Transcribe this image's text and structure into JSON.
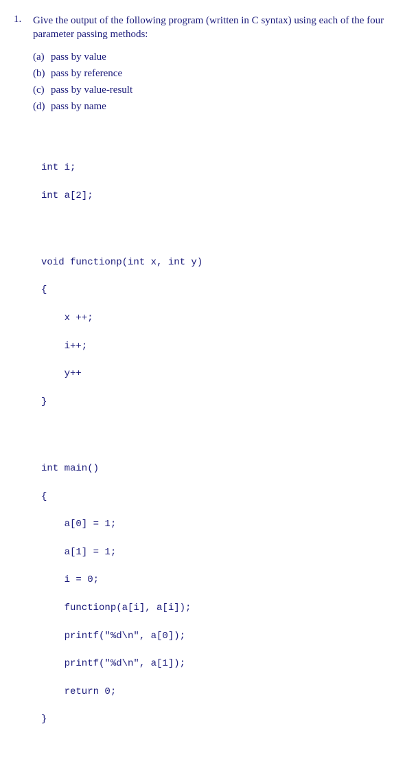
{
  "question": {
    "number": "1.",
    "text": "Give the output of the following program (written in C syntax) using each of the four parameter passing methods:"
  },
  "subitems": [
    {
      "label": "(a)",
      "text": "pass by value"
    },
    {
      "label": "(b)",
      "text": "pass by reference"
    },
    {
      "label": "(c)",
      "text": "pass by value-result"
    },
    {
      "label": "(d)",
      "text": "pass by name"
    }
  ],
  "code": {
    "decl1": "int i;",
    "decl2": "int a[2];",
    "funcsig": "void functionp(int x, int y)",
    "open1": "{",
    "f1": "    x ++;",
    "f2": "    i++;",
    "f3": "    y++",
    "close1": "}",
    "mainsig": "int main()",
    "open2": "{",
    "m1": "    a[0] = 1;",
    "m2": "    a[1] = 1;",
    "m3": "    i = 0;",
    "m4": "    functionp(a[i], a[i]);",
    "m5": "    printf(\"%d\\n\", a[0]);",
    "m6": "    printf(\"%d\\n\", a[1]);",
    "m7": "    return 0;",
    "close2": "}"
  }
}
